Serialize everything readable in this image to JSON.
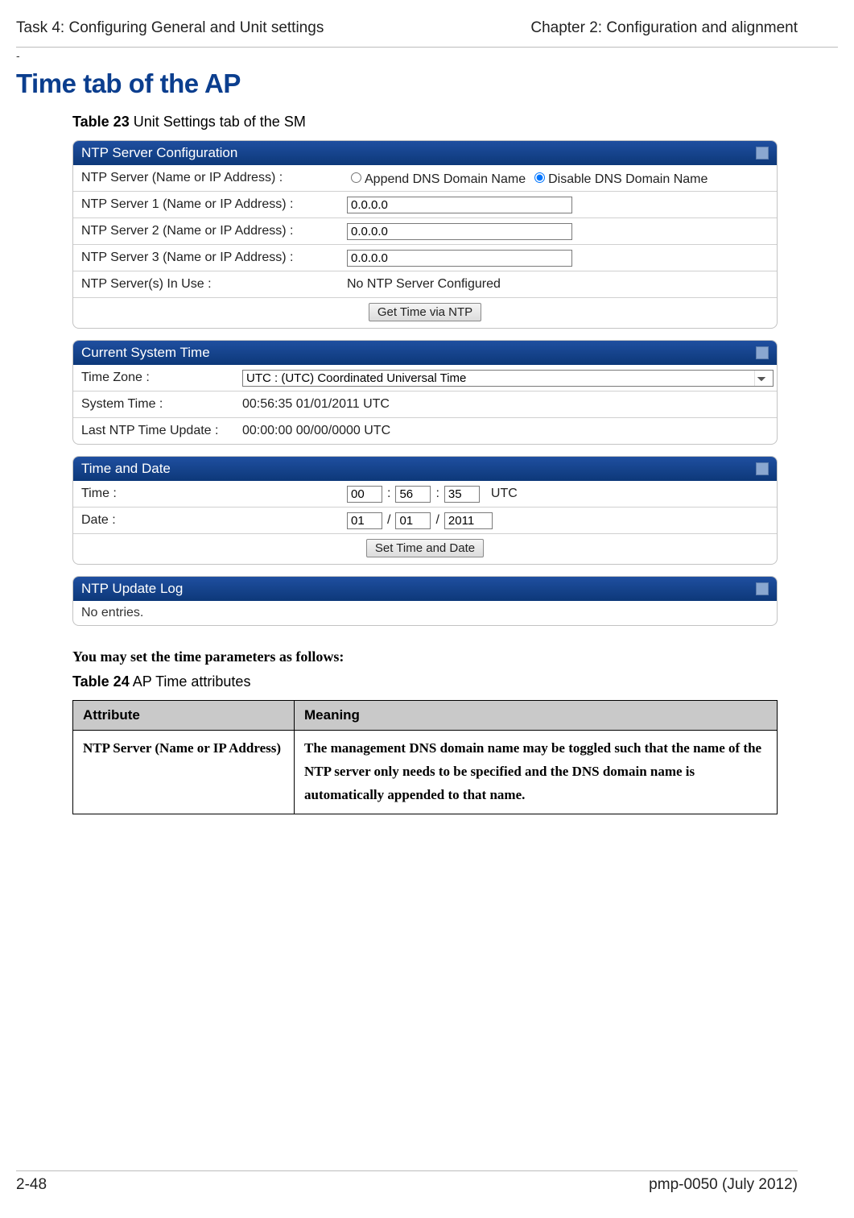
{
  "header": {
    "left": "Task 4: Configuring General and Unit settings",
    "right": "Chapter 2:  Configuration and alignment"
  },
  "dash": "-",
  "section_title": "Time tab of the AP",
  "table23_caption_bold": "Table 23",
  "table23_caption_rest": "  Unit Settings tab of the SM",
  "ntp_panel": {
    "title": "NTP Server Configuration",
    "row_dns": {
      "label": "NTP Server (Name or IP Address) :",
      "opt_append": "Append DNS Domain Name",
      "opt_disable": "Disable DNS Domain Name"
    },
    "row1": {
      "label": "NTP Server 1 (Name or IP Address) :",
      "value": "0.0.0.0"
    },
    "row2": {
      "label": "NTP Server 2 (Name or IP Address) :",
      "value": "0.0.0.0"
    },
    "row3": {
      "label": "NTP Server 3 (Name or IP Address) :",
      "value": "0.0.0.0"
    },
    "inuse": {
      "label": "NTP Server(s) In Use :",
      "value": "No NTP Server Configured"
    },
    "btn": "Get Time via NTP"
  },
  "systime_panel": {
    "title": "Current System Time",
    "tz": {
      "label": "Time Zone :",
      "value": "UTC : (UTC) Coordinated Universal Time"
    },
    "systime": {
      "label": "System Time :",
      "value": "00:56:35 01/01/2011 UTC"
    },
    "lastupd": {
      "label": "Last NTP Time Update :",
      "value": "00:00:00 00/00/0000 UTC"
    }
  },
  "timedate_panel": {
    "title": "Time and Date",
    "time": {
      "label": "Time :",
      "hh": "00",
      "mm": "56",
      "ss": "35",
      "suffix": "UTC"
    },
    "date": {
      "label": "Date :",
      "m": "01",
      "d": "01",
      "y": "2011"
    },
    "btn": "Set Time and Date"
  },
  "log_panel": {
    "title": "NTP Update Log",
    "text": "No entries."
  },
  "intro": "You may set the time parameters as follows:",
  "table24_caption_bold": "Table 24",
  "table24_caption_rest": "  AP Time attributes",
  "attr_table": {
    "h1": "Attribute",
    "h2": "Meaning",
    "r1_attr": "NTP Server (Name or IP Address)",
    "r1_mean": "The management DNS domain name may be toggled such that the name of the NTP server only needs to be specified and the DNS domain name is automatically appended to that name."
  },
  "footer": {
    "left": "2-48",
    "right": "pmp-0050 (July 2012)"
  }
}
